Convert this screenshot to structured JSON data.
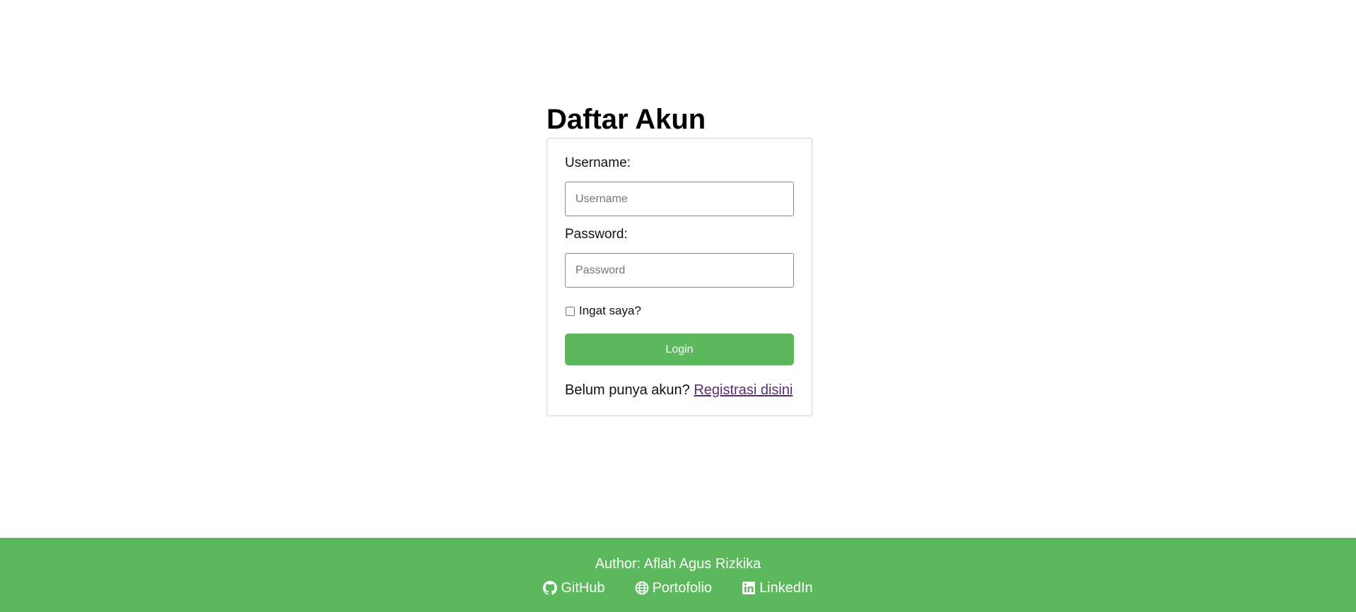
{
  "page_title": "Daftar Akun",
  "form": {
    "username_label": "Username:",
    "username_placeholder": "Username",
    "username_value": "",
    "password_label": "Password:",
    "password_placeholder": "Password",
    "password_value": "",
    "remember_label": "Ingat saya?",
    "remember_checked": false,
    "login_label": "Login",
    "register_prompt": "Belum punya akun?",
    "register_link": "Registrasi disini"
  },
  "footer": {
    "author": "Author: Aflah Agus Rizkika",
    "links": [
      {
        "label": "GitHub",
        "icon": "github-icon"
      },
      {
        "label": "Portofolio",
        "icon": "globe-icon"
      },
      {
        "label": "LinkedIn",
        "icon": "linkedin-icon"
      }
    ]
  },
  "colors": {
    "accent": "#5cb85c",
    "link_visited": "#5a2a7a",
    "card_border": "#d0d0d0"
  }
}
